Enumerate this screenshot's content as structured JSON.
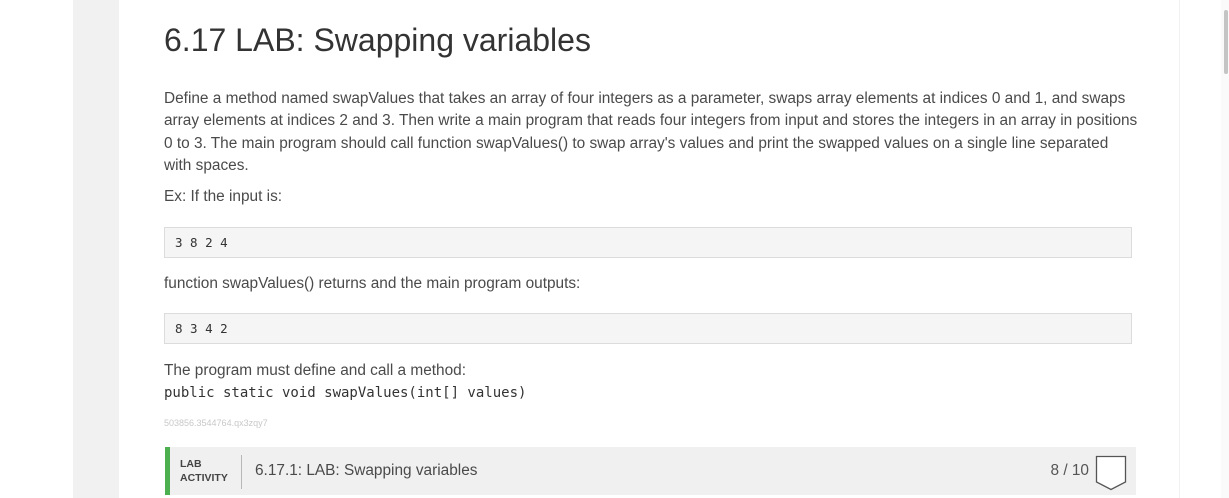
{
  "section": {
    "title": "6.17 LAB: Swapping variables",
    "description": "Define a method named swapValues that takes an array of four integers as a parameter, swaps array elements at indices 0 and 1, and swaps array elements at indices 2 and 3. Then write a main program that reads four integers from input and stores the integers in an array in positions 0 to 3. The main program should call function swapValues() to swap array's values and print the swapped values on a single line separated with spaces.",
    "example_label": "Ex: If the input is:",
    "example_input": "3 8 2 4",
    "returns_label": "function swapValues() returns and the main program outputs:",
    "example_output": "8 3 4 2",
    "must_define_label": "The program must define and call a method:",
    "method_signature": "public static void swapValues(int[] values)",
    "fingerprint": "503856.3544764.qx3zqy7"
  },
  "lab_activity": {
    "tag_line1": "LAB",
    "tag_line2": "ACTIVITY",
    "title": "6.17.1: LAB: Swapping variables",
    "score": "8 / 10",
    "accent_color": "#4caf50",
    "badge_icon": "shield-badge-icon"
  }
}
